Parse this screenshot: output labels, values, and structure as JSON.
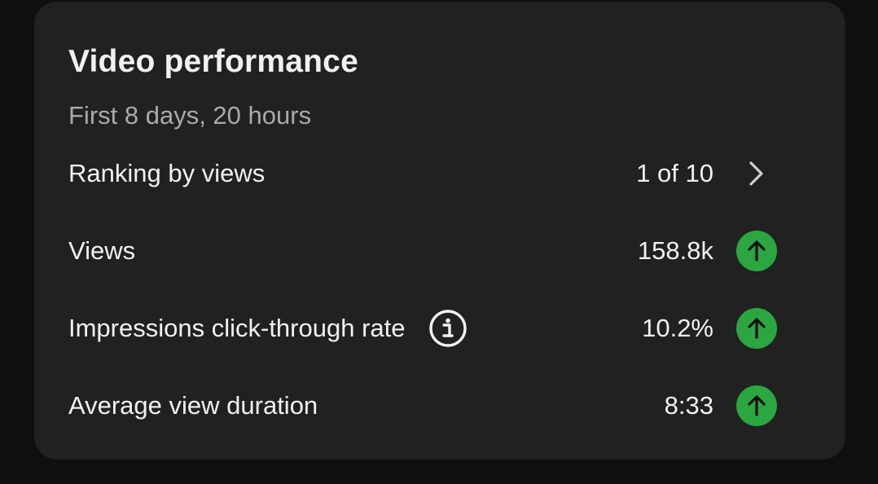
{
  "card": {
    "title": "Video performance",
    "subtitle": "First 8 days, 20 hours"
  },
  "metrics": [
    {
      "label": "Ranking by views",
      "value": "1 of 10",
      "icon": "chevron-right-icon"
    },
    {
      "label": "Views",
      "value": "158.8k",
      "icon": "arrow-up-icon"
    },
    {
      "label": "Impressions click-through rate",
      "value": "10.2%",
      "icon": "arrow-up-icon",
      "info_icon": "info-icon"
    },
    {
      "label": "Average view duration",
      "value": "8:33",
      "icon": "arrow-up-icon"
    }
  ],
  "colors": {
    "background": "#0f0f0f",
    "card": "#212121",
    "trend_up": "#2ba640",
    "text_primary": "#f1f1f1",
    "text_secondary": "#aaaaaa"
  }
}
